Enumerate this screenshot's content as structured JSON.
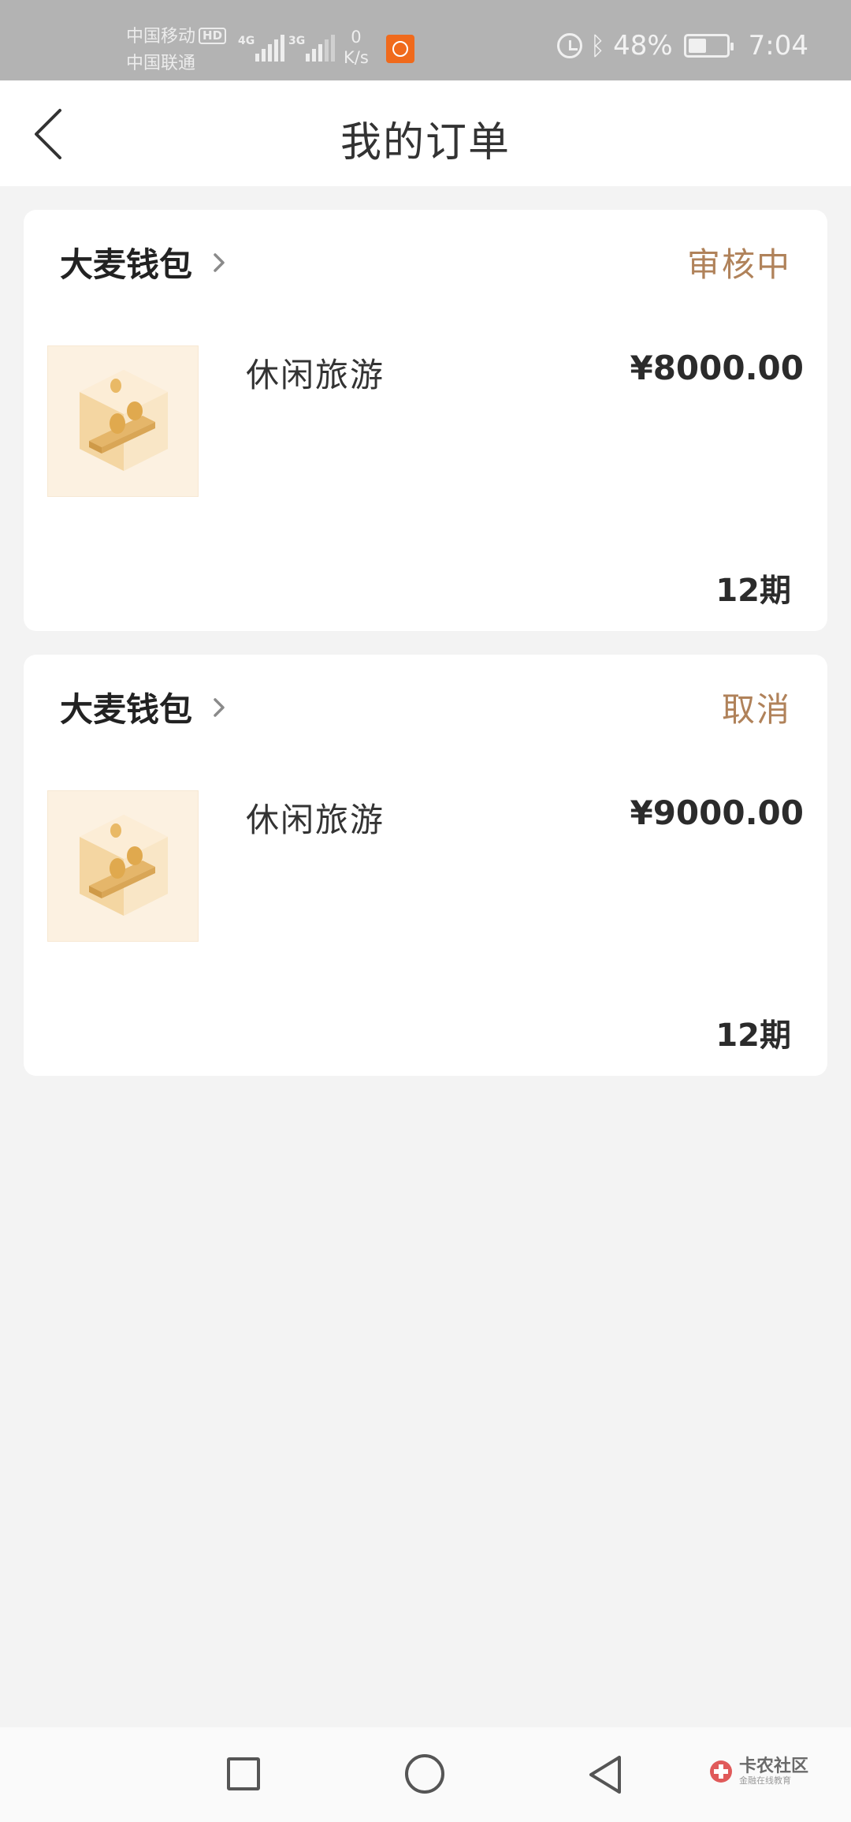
{
  "status_bar": {
    "carrier_1": "中国移动",
    "carrier_2": "中国联通",
    "hd_badge": "HD",
    "signal_1_tag": "4G",
    "signal_2_tag": "3G",
    "net_speed_value": "0",
    "net_speed_unit": "K/s",
    "battery_percent": "48%",
    "battery_level": 0.48,
    "time": "7:04"
  },
  "header": {
    "title": "我的订单",
    "back_icon": "chevron-left-icon"
  },
  "orders": [
    {
      "merchant": "大麦钱包",
      "status": "审核中",
      "product": "休闲旅游",
      "price": "¥8000.00",
      "term": "12期"
    },
    {
      "merchant": "大麦钱包",
      "status": "取消",
      "product": "休闲旅游",
      "price": "¥9000.00",
      "term": "12期"
    }
  ],
  "nav_bar": {
    "recent_icon": "square-icon",
    "home_icon": "circle-icon",
    "back_icon": "triangle-back-icon"
  },
  "watermark": {
    "text": "卡农社区",
    "subtext": "金融在线教育"
  },
  "colors": {
    "status_text": "#b0825a",
    "status_bar_bg": "#b3b3b3",
    "page_bg": "#f3f3f3",
    "card_bg": "#ffffff",
    "app_badge": "#f06a1c"
  }
}
